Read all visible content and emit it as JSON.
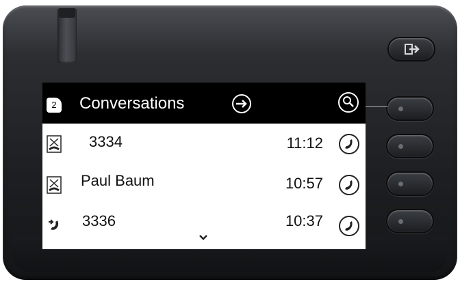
{
  "header": {
    "badge_count": "2",
    "title": "Conversations",
    "arrow_icon": "arrow-right-icon",
    "search_icon": "search-icon"
  },
  "conversations": [
    {
      "name": "3334",
      "time": "11:12",
      "status_icon": "missed-call-icon",
      "action_icon": "call-icon"
    },
    {
      "name": "Paul Baum",
      "time": "10:57",
      "status_icon": "missed-call-icon",
      "action_icon": "call-icon"
    },
    {
      "name": "3336",
      "time": "10:37",
      "status_icon": "incoming-call-icon",
      "action_icon": "call-icon"
    }
  ],
  "hardware": {
    "top_button_icon": "exit-icon",
    "side_keys": 4
  },
  "colors": {
    "header_bg": "#000000",
    "screen_bg": "#ffffff",
    "housing": "#1d1f22"
  }
}
